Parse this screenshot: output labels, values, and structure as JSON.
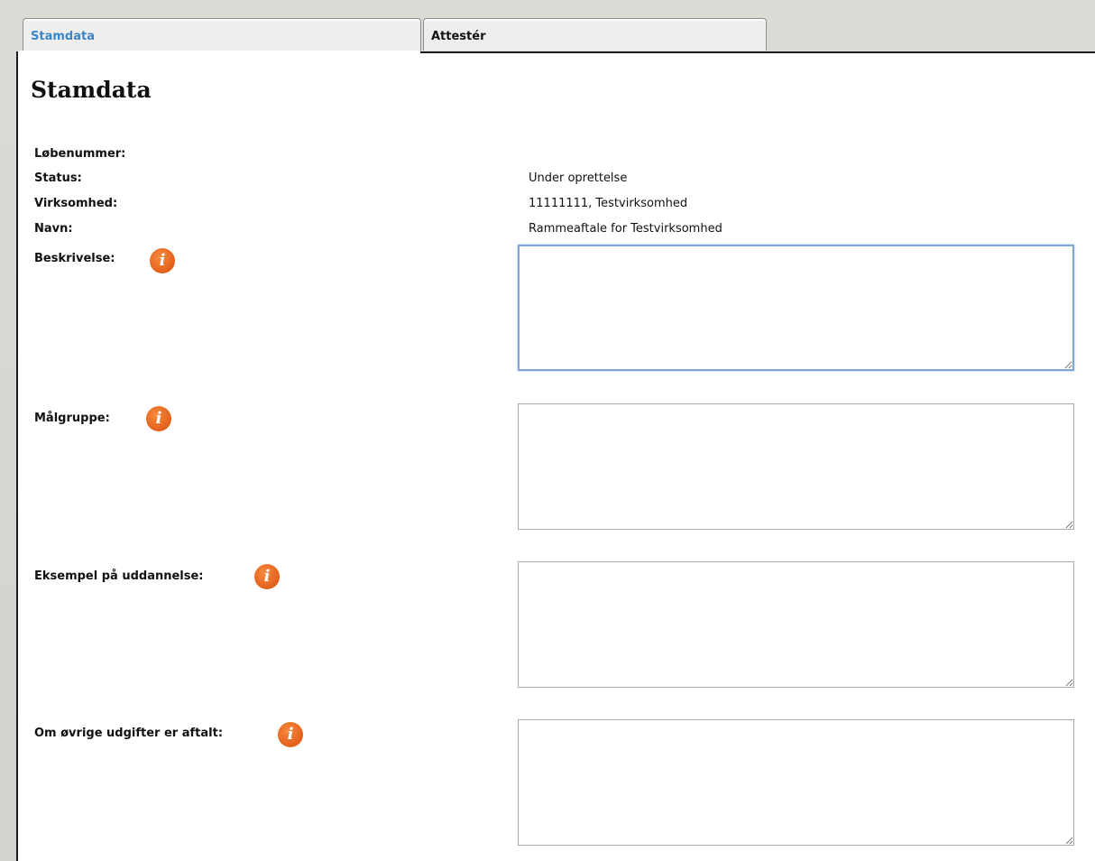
{
  "tabs": [
    {
      "label": "Stamdata",
      "active": true
    },
    {
      "label": "Attestér",
      "active": false
    }
  ],
  "page_title": "Stamdata",
  "fields": {
    "lobenummer": {
      "label": "Løbenummer:",
      "value": ""
    },
    "status": {
      "label": "Status:",
      "value": "Under oprettelse"
    },
    "virksomhed": {
      "label": "Virksomhed:",
      "value": "11111111, Testvirksomhed"
    },
    "navn": {
      "label": "Navn:",
      "value": "Rammeaftale for Testvirksomhed"
    },
    "beskrivelse": {
      "label": "Beskrivelse:",
      "value": ""
    },
    "malgruppe": {
      "label": "Målgruppe:",
      "value": ""
    },
    "eksempel": {
      "label": "Eksempel på uddannelse:",
      "value": ""
    },
    "ovrige": {
      "label": "Om øvrige udgifter er aftalt:",
      "value": ""
    }
  },
  "icons": {
    "info": "info-icon",
    "info_glyph": "i"
  },
  "colors": {
    "info_orange": "#e2601a",
    "active_tab_text": "#3d86c6",
    "focus_border": "#7fa7d8"
  }
}
